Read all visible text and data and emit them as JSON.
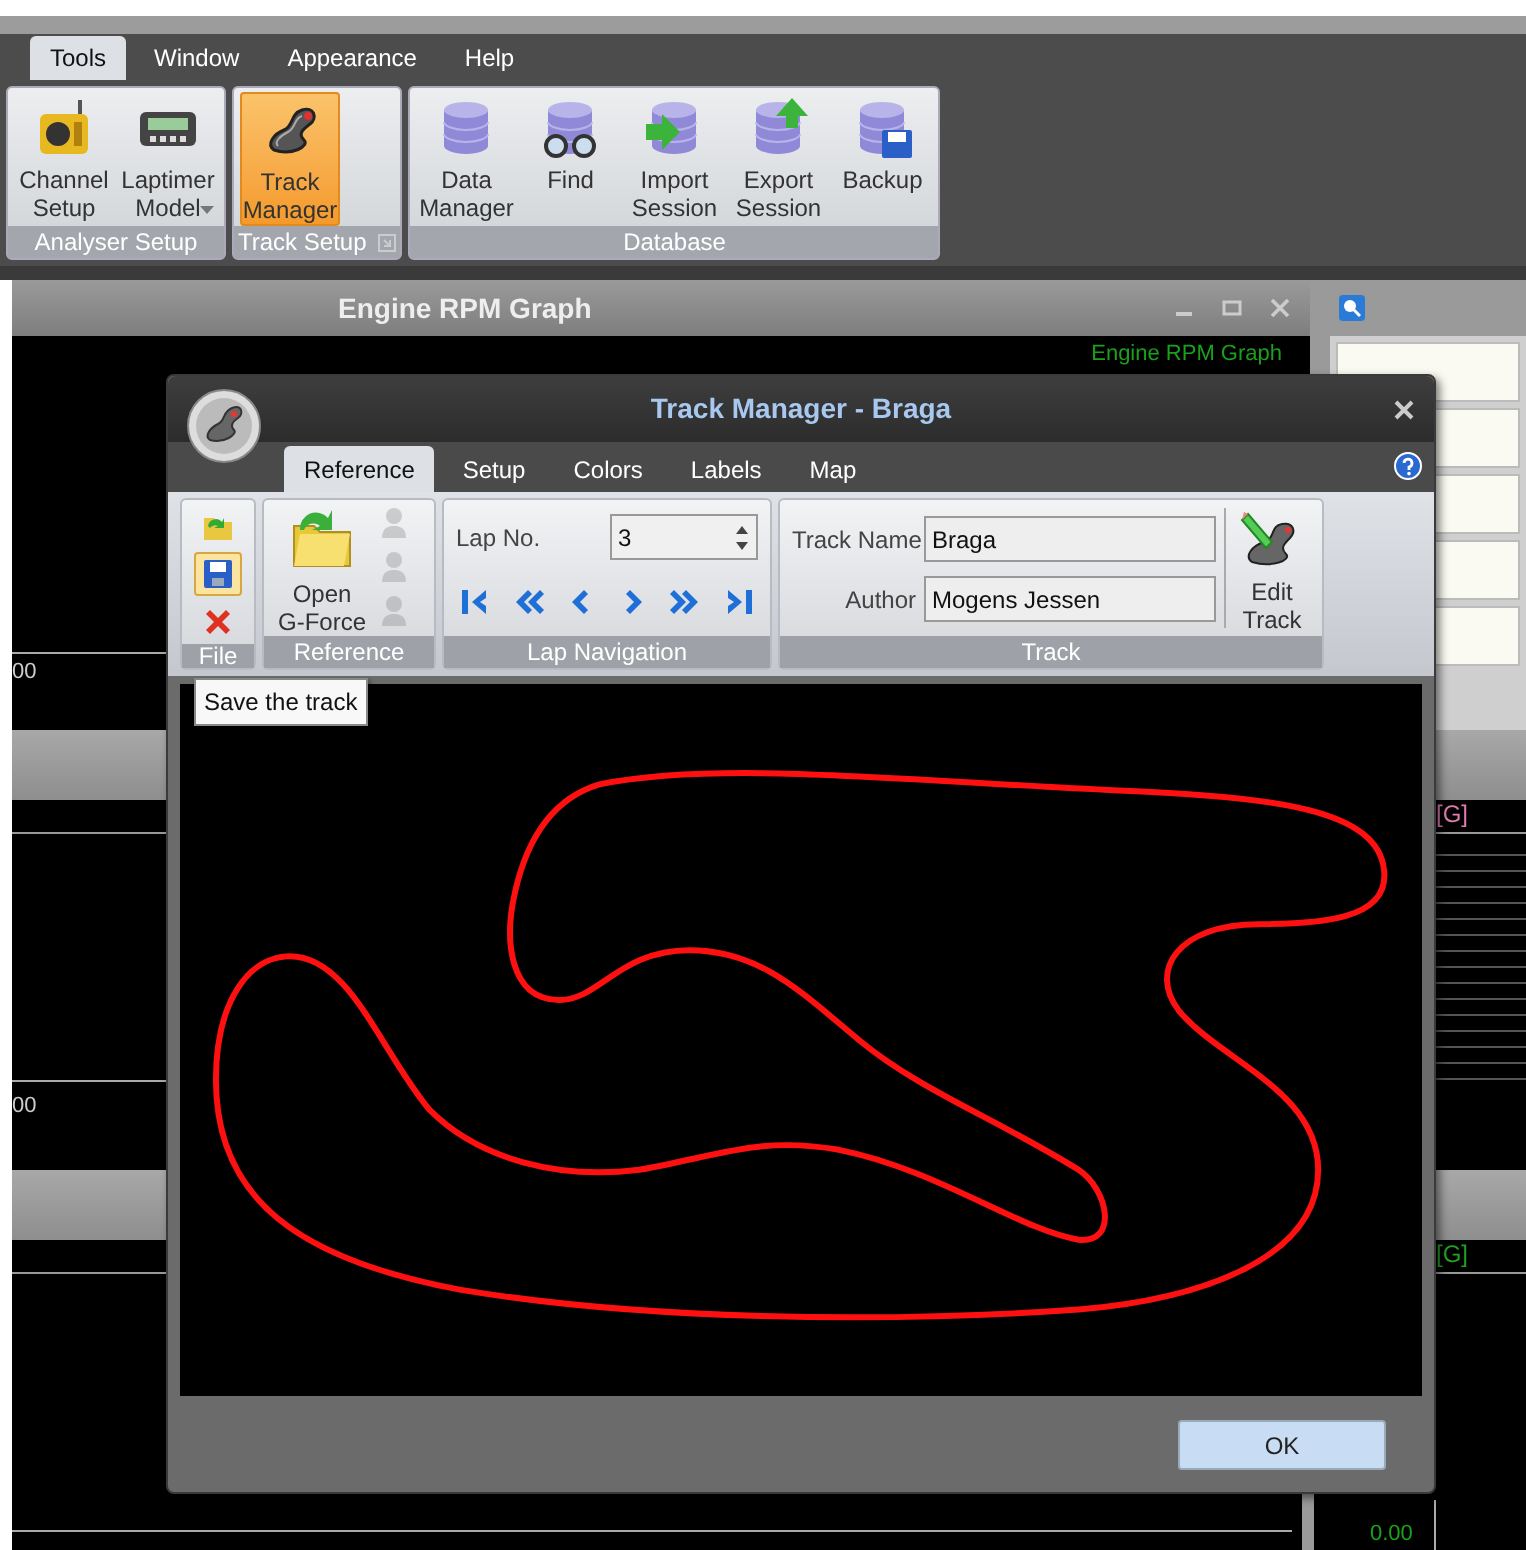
{
  "menu_tabs": [
    {
      "label": "Tools",
      "selected": true
    },
    {
      "label": "Window",
      "selected": false
    },
    {
      "label": "Appearance",
      "selected": false
    },
    {
      "label": "Help",
      "selected": false
    }
  ],
  "ribbon_groups": [
    {
      "label": "Analyser Setup",
      "launcher": false,
      "buttons": [
        {
          "label": "Channel Setup",
          "selected": false,
          "dropdown": false
        },
        {
          "label": "Laptimer Model",
          "selected": false,
          "dropdown": true
        }
      ]
    },
    {
      "label": "Track Setup",
      "launcher": true,
      "buttons": [
        {
          "label": "Track Manager",
          "selected": true,
          "dropdown": false
        }
      ]
    },
    {
      "label": "Database",
      "launcher": false,
      "buttons": [
        {
          "label": "Data Manager",
          "selected": false,
          "dropdown": false
        },
        {
          "label": "Find",
          "selected": false,
          "dropdown": false
        },
        {
          "label": "Import Session",
          "selected": false,
          "dropdown": false
        },
        {
          "label": "Export Session",
          "selected": false,
          "dropdown": false
        },
        {
          "label": "Backup",
          "selected": false,
          "dropdown": false
        }
      ]
    }
  ],
  "graph_panels": [
    {
      "title": "Engine RPM Graph",
      "legend": "Engine RPM Graph",
      "axis_label": "00"
    },
    {
      "axis_label": "00",
      "unit": "[G]",
      "color": "#e07ab0"
    },
    {
      "unit": "[G]",
      "color": "#22a022",
      "value": "0.00"
    }
  ],
  "dialog": {
    "title": "Track Manager - Braga",
    "tabs": [
      {
        "label": "Reference",
        "selected": true
      },
      {
        "label": "Setup",
        "selected": false
      },
      {
        "label": "Colors",
        "selected": false
      },
      {
        "label": "Labels",
        "selected": false
      },
      {
        "label": "Map",
        "selected": false
      }
    ],
    "file_group": {
      "label": "File",
      "buttons": [
        {
          "highlighted": false
        },
        {
          "highlighted": true
        },
        {
          "highlighted": false
        }
      ]
    },
    "reference_group": {
      "label": "Reference",
      "button": "Open G-Force",
      "people": [
        {
          "disabled": true
        },
        {
          "disabled": true
        },
        {
          "disabled": true
        }
      ]
    },
    "lap_navigation": {
      "label": "Lap Navigation",
      "lap_label": "Lap No.",
      "lap_value": "3"
    },
    "track_group": {
      "label": "Track",
      "name_label": "Track Name",
      "name_value": "Braga",
      "author_label": "Author",
      "author_value": "Mogens Jessen",
      "edit_button": "Edit Track"
    },
    "tooltip": "Save the track",
    "ok_button": "OK"
  }
}
